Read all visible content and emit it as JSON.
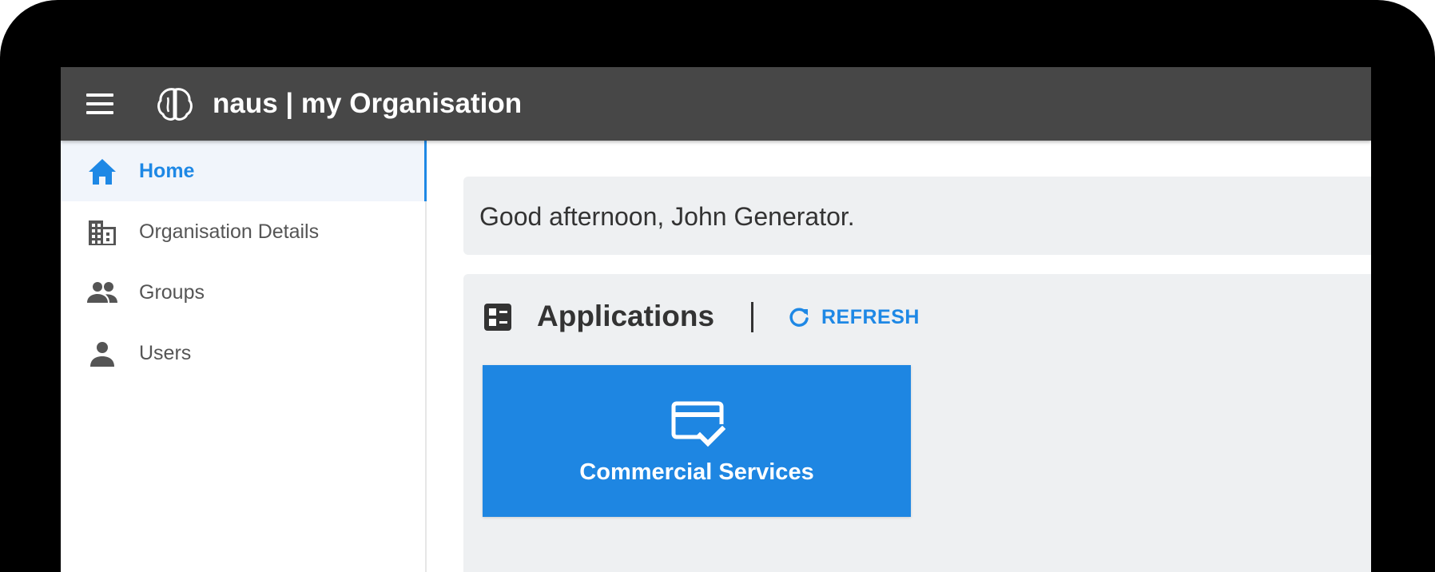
{
  "appbar": {
    "title": "naus | my Organisation",
    "menu_icon": "hamburger-menu-icon",
    "logo_icon": "brain-logo-icon",
    "background_color": "#474747"
  },
  "sidebar": {
    "items": [
      {
        "label": "Home",
        "icon": "home-icon",
        "active": true
      },
      {
        "label": "Organisation Details",
        "icon": "building-icon",
        "active": false
      },
      {
        "label": "Groups",
        "icon": "people-icon",
        "active": false
      },
      {
        "label": "Users",
        "icon": "person-icon",
        "active": false
      }
    ],
    "active_color": "#1e88e5"
  },
  "main": {
    "greeting": "Good afternoon, John Generator.",
    "applications": {
      "title": "Applications",
      "header_icon": "dashboard-icon",
      "refresh_label": "REFRESH",
      "refresh_icon": "refresh-icon",
      "tiles": [
        {
          "label": "Commercial Services",
          "icon": "card-check-icon",
          "color": "#1e86e2"
        }
      ]
    }
  }
}
